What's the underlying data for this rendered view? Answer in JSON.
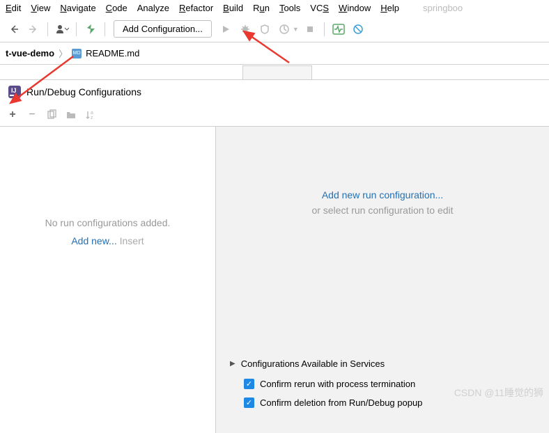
{
  "menu": {
    "edit": "Edit",
    "view": "View",
    "navigate": "Navigate",
    "code": "Code",
    "analyze": "Analyze",
    "refactor": "Refactor",
    "build": "Build",
    "run": "Run",
    "tools": "Tools",
    "vcs": "VCS",
    "window": "Window",
    "help": "Help",
    "project_hint": "springboo"
  },
  "toolbar": {
    "config_button": "Add Configuration..."
  },
  "breadcrumb": {
    "project": "t-vue-demo",
    "file": "README.md",
    "file_badge": "MD"
  },
  "dialog": {
    "title": "Run/Debug Configurations",
    "left": {
      "empty_message": "No run configurations added.",
      "add_new": "Add new...",
      "insert_hint": "Insert"
    },
    "right": {
      "add_new_config": "Add new run configuration...",
      "or_select": "or select run configuration to edit",
      "section_title": "Configurations Available in Services",
      "check1": "Confirm rerun with process termination",
      "check2": "Confirm deletion from Run/Debug popup"
    }
  },
  "watermark": "CSDN @11睡觉的狮"
}
